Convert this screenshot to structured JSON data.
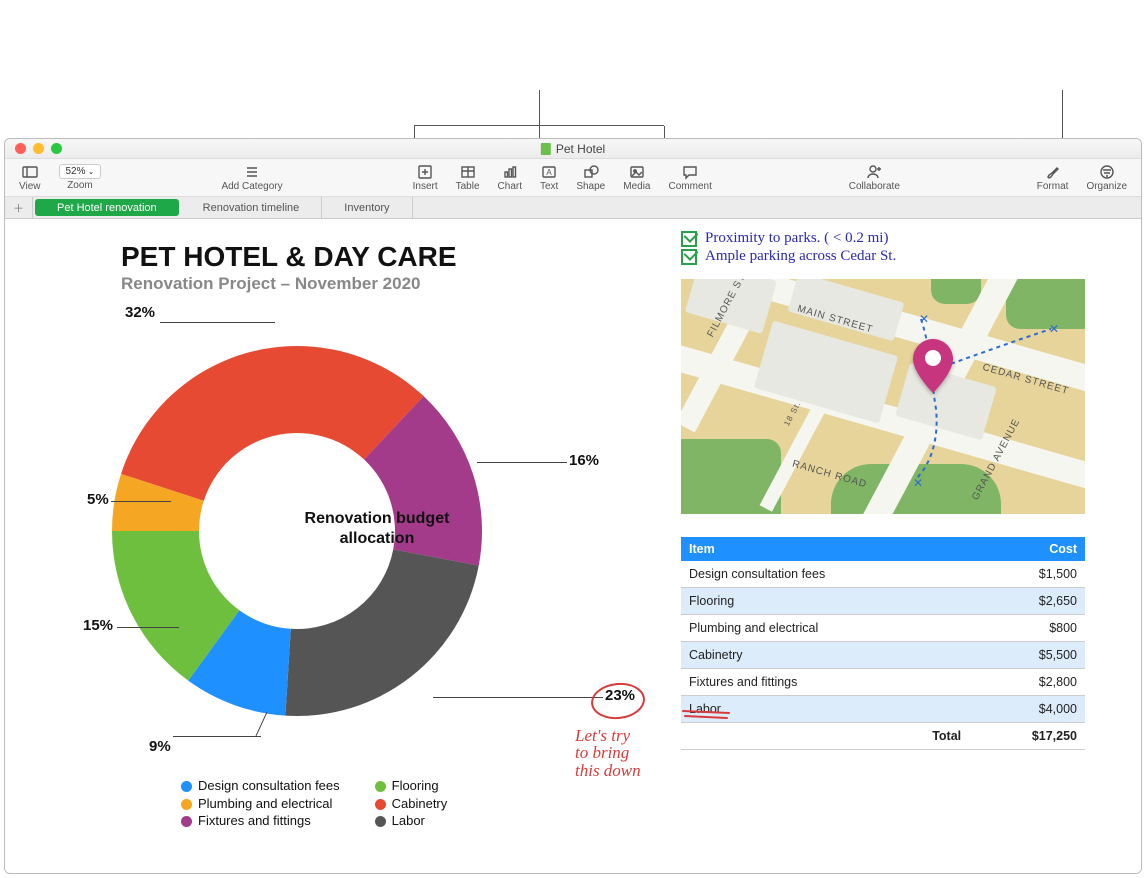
{
  "window": {
    "title": "Pet Hotel"
  },
  "toolbar": {
    "view": "View",
    "zoom_label": "Zoom",
    "zoom_value": "52%",
    "add_category": "Add Category",
    "insert": "Insert",
    "table": "Table",
    "chart": "Chart",
    "text": "Text",
    "shape": "Shape",
    "media": "Media",
    "comment": "Comment",
    "collaborate": "Collaborate",
    "format": "Format",
    "organize": "Organize"
  },
  "sheets": {
    "tabs": [
      {
        "label": "Pet Hotel renovation",
        "active": true
      },
      {
        "label": "Renovation timeline",
        "active": false
      },
      {
        "label": "Inventory",
        "active": false
      }
    ]
  },
  "document": {
    "title": "PET HOTEL & DAY CARE",
    "subtitle": "Renovation Project – November 2020",
    "chart_title": "Renovation budget allocation"
  },
  "chart_data": {
    "type": "pie",
    "title": "Renovation budget allocation",
    "series": [
      {
        "name": "Design consultation fees",
        "value": 9,
        "color": "#1e90ff",
        "label": "9%"
      },
      {
        "name": "Flooring",
        "value": 15,
        "color": "#6fbf3f",
        "label": "15%"
      },
      {
        "name": "Plumbing and electrical",
        "value": 5,
        "color": "#f5a623",
        "label": "5%"
      },
      {
        "name": "Cabinetry",
        "value": 32,
        "color": "#e64a33",
        "label": "32%"
      },
      {
        "name": "Fixtures and fittings",
        "value": 16,
        "color": "#a43a8a",
        "label": "16%"
      },
      {
        "name": "Labor",
        "value": 23,
        "color": "#555555",
        "label": "23%"
      }
    ]
  },
  "legend": {
    "col1": [
      "Design consultation fees",
      "Plumbing and electrical",
      "Fixtures and fittings"
    ],
    "col2": [
      "Flooring",
      "Cabinetry",
      "Labor"
    ],
    "colors": {
      "Design consultation fees": "#1e90ff",
      "Plumbing and electrical": "#f5a623",
      "Fixtures and fittings": "#a43a8a",
      "Flooring": "#6fbf3f",
      "Cabinetry": "#e64a33",
      "Labor": "#555555"
    }
  },
  "handwritten": {
    "check1": "Proximity to parks. ( < 0.2 mi)",
    "check2": "Ample parking across Cedar St.",
    "red_line1": "Let's try",
    "red_line2": "to bring",
    "red_line3": "this down"
  },
  "map_labels": {
    "filmore": "FILMORE ST.",
    "main": "MAIN STREET",
    "ranch": "RANCH ROAD",
    "grand": "GRAND AVENUE",
    "cedar": "CEDAR STREET",
    "eighteen": "18 St."
  },
  "cost_table": {
    "headers": [
      "Item",
      "Cost"
    ],
    "rows": [
      {
        "item": "Design consultation fees",
        "cost": "$1,500",
        "alt": false
      },
      {
        "item": "Flooring",
        "cost": "$2,650",
        "alt": true
      },
      {
        "item": "Plumbing and electrical",
        "cost": "$800",
        "alt": false
      },
      {
        "item": "Cabinetry",
        "cost": "$5,500",
        "alt": true
      },
      {
        "item": "Fixtures and fittings",
        "cost": "$2,800",
        "alt": false
      },
      {
        "item": "Labor",
        "cost": "$4,000",
        "alt": true
      }
    ],
    "total_label": "Total",
    "total_value": "$17,250"
  }
}
